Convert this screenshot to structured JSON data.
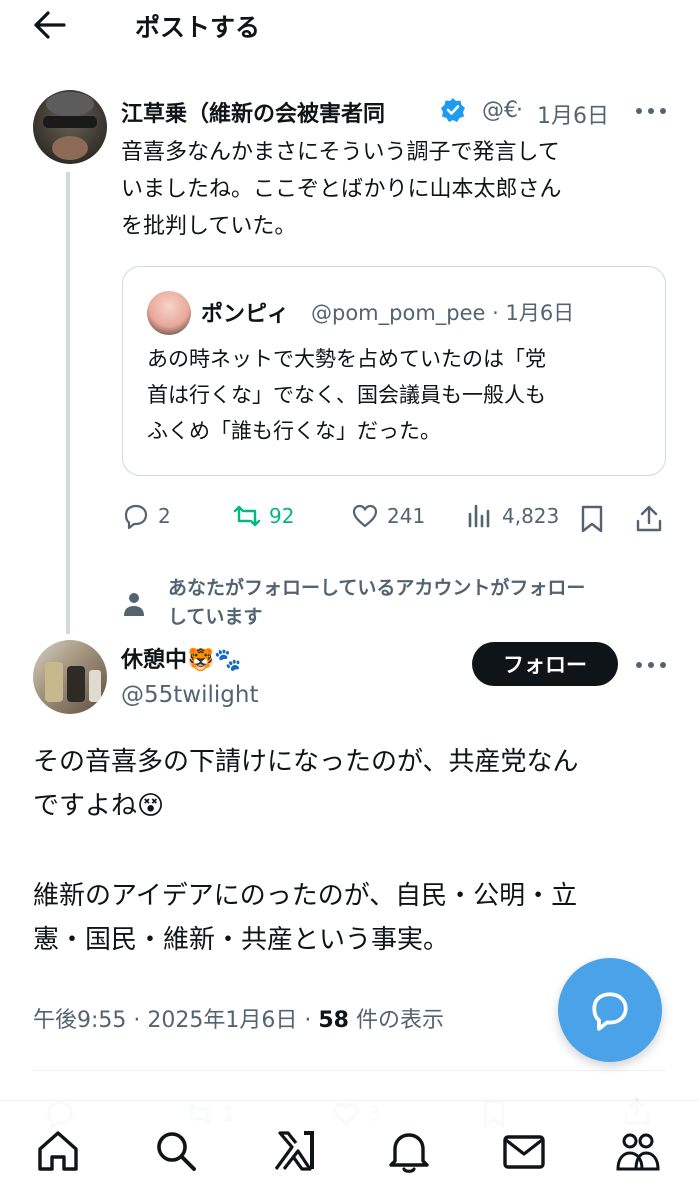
{
  "header": {
    "title": "ポストする"
  },
  "parent_post": {
    "name": "江草乗（維新の会被害者同",
    "handle": "@€",
    "date": "1月6日",
    "text_lines": [
      "音喜多なんかまさにそういう調子で発言して",
      "いましたね。ここぞとばかりに山本太郎さん",
      "を批判していた。"
    ],
    "quote": {
      "name": "ポンピィ",
      "handle_date": "@pom_pom_pee · 1月6日",
      "text_lines": [
        "あの時ネットで大勢を占めていたのは「党",
        "首は行くな」でなく、国会議員も一般人も",
        "ふくめ「誰も行くな」だった。"
      ]
    },
    "stats": {
      "replies": "2",
      "reposts": "92",
      "likes": "241",
      "views": "4,823"
    }
  },
  "social_context": {
    "lines": [
      "あなたがフォローしているアカウントがフォロー",
      "しています"
    ]
  },
  "main_post": {
    "name": "休憩中🐯🐾",
    "handle": "@55twilight",
    "follow_label": "フォロー",
    "paragraph1_lines": [
      "その音喜多の下請けになったのが、共産党なん",
      "ですよね😵"
    ],
    "paragraph2_lines": [
      "維新のアイデアにのったのが、自民・公明・立",
      "憲・国民・維新・共産という事実。"
    ],
    "time": "午後9:55 · 2025年1月6日 · ",
    "views_count": "58",
    "views_label": " 件の表示",
    "faded_stats": {
      "reposts": "1",
      "likes": "3"
    }
  },
  "icons": {
    "back": "back-arrow-icon",
    "verified": "verified-badge-icon",
    "more": "more-icon",
    "reply": "reply-icon",
    "repost": "repost-icon",
    "like": "heart-icon",
    "views": "views-icon",
    "bookmark": "bookmark-icon",
    "share": "share-icon",
    "compose": "compose-reply-icon",
    "nav": [
      "home-icon",
      "search-icon",
      "grok-icon",
      "notifications-icon",
      "messages-icon",
      "communities-icon"
    ]
  },
  "colors": {
    "repost_green": "#00ba7c",
    "verified_blue": "#1d9bf0",
    "fab_blue": "#4aa3e8",
    "follow_bg": "#0f1419"
  }
}
